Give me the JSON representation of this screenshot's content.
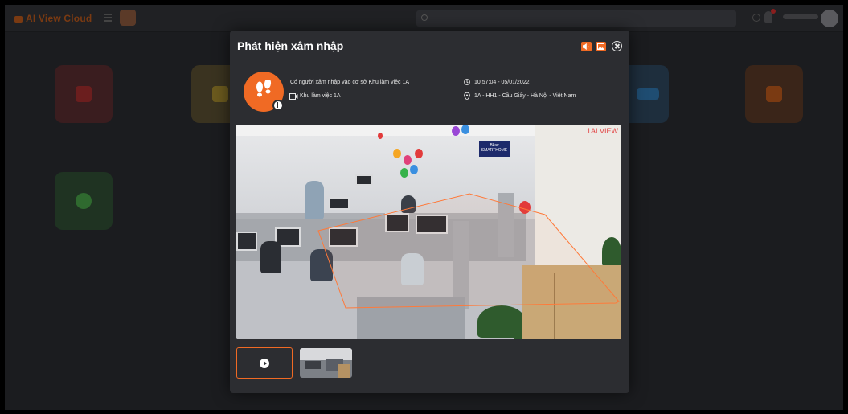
{
  "app": {
    "brand": "AI View Cloud"
  },
  "modal": {
    "title": "Phát hiện xâm nhập",
    "event": {
      "description": "Có người xâm nhập vào cơ sở Khu làm việc 1A",
      "camera": "Khu làm việc 1A",
      "time": "10:57:04 - 05/01/2022",
      "location": "1A - HH1 - Cầu Giấy - Hà Nội - Việt Nam"
    },
    "video": {
      "camera_label": "1AI VIEW",
      "sign_text": "Bkav SMARTHOME"
    },
    "icons": {
      "event": "footprints-icon",
      "camera": "camera-icon",
      "time": "clock-icon",
      "location": "map-pin-icon",
      "header_button_1": "volume-icon",
      "header_button_2": "image-icon",
      "close": "close-icon",
      "play": "play-icon"
    }
  },
  "colors": {
    "accent": "#f06a24",
    "modal_bg": "#2c2d31",
    "zone_outline": "#ff7a3a"
  }
}
